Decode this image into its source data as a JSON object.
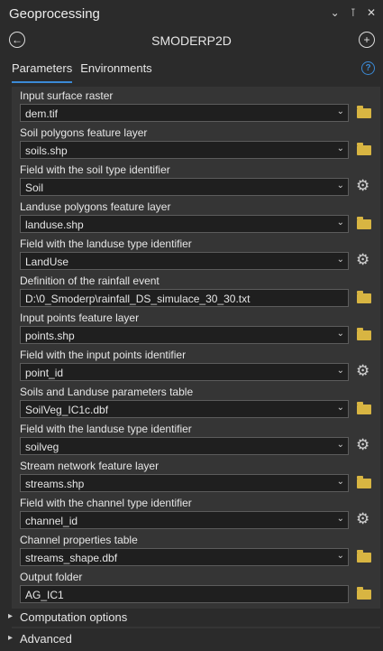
{
  "pane": {
    "title": "Geoprocessing",
    "controls": [
      "⌄",
      "⊺",
      "✕"
    ]
  },
  "tool": {
    "name": "SMODERP2D",
    "back_icon": "back-arrow-icon",
    "add_icon": "plus-icon"
  },
  "tabs": [
    {
      "label": "Parameters",
      "active": true
    },
    {
      "label": "Environments",
      "active": false
    }
  ],
  "help_glyph": "?",
  "accent_color": "#3b8ad6",
  "params": [
    {
      "label": "Input surface raster",
      "value": "dem.tif",
      "dropdown": true,
      "action": "folder"
    },
    {
      "label": "Soil polygons feature layer",
      "value": "soils.shp",
      "dropdown": true,
      "action": "folder"
    },
    {
      "label": "Field with the soil type identifier",
      "value": "Soil",
      "dropdown": true,
      "action": "gear"
    },
    {
      "label": "Landuse polygons feature layer",
      "value": "landuse.shp",
      "dropdown": true,
      "action": "folder"
    },
    {
      "label": "Field with the landuse type identifier",
      "value": "LandUse",
      "dropdown": true,
      "action": "gear"
    },
    {
      "label": "Definition of the rainfall event",
      "value": "D:\\0_Smoderp\\rainfall_DS_simulace_30_30.txt",
      "dropdown": false,
      "action": "folder"
    },
    {
      "label": "Input points feature layer",
      "value": "points.shp",
      "dropdown": true,
      "action": "folder"
    },
    {
      "label": "Field with the input points identifier",
      "value": "point_id",
      "dropdown": true,
      "action": "gear"
    },
    {
      "label": "Soils and Landuse parameters table",
      "value": "SoilVeg_IC1c.dbf",
      "dropdown": true,
      "action": "folder"
    },
    {
      "label": "Field with the landuse type identifier",
      "value": "soilveg",
      "dropdown": true,
      "action": "gear"
    },
    {
      "label": "Stream network feature layer",
      "value": "streams.shp",
      "dropdown": true,
      "action": "folder"
    },
    {
      "label": "Field with the channel type identifier",
      "value": "channel_id",
      "dropdown": true,
      "action": "gear"
    },
    {
      "label": "Channel properties table",
      "value": "streams_shape.dbf",
      "dropdown": true,
      "action": "folder"
    },
    {
      "label": "Output folder",
      "value": "AG_IC1",
      "dropdown": false,
      "action": "folder"
    }
  ],
  "sections": [
    {
      "label": "Computation options"
    },
    {
      "label": "Advanced"
    }
  ]
}
